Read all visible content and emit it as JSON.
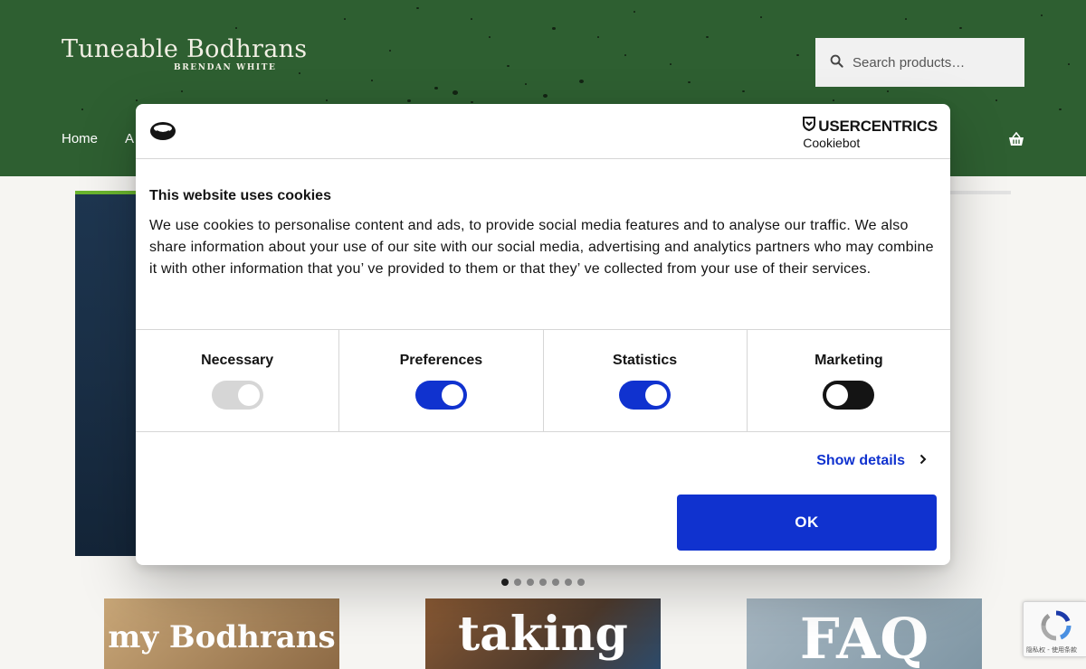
{
  "header": {
    "logo_title": "Tuneable Bodhrans",
    "logo_subtitle": "BRENDAN WHITE",
    "search_placeholder": "Search products…",
    "nav_items": [
      "Home",
      "A"
    ],
    "background_color": "#2e5f31"
  },
  "slider": {
    "slide_count": 7,
    "active_index": 0
  },
  "tiles": [
    {
      "text": "my Bodhrans",
      "color": "#a7865c"
    },
    {
      "text": "taking",
      "color": "#6b4a2e"
    },
    {
      "text": "FAQ",
      "color": "#8fa3b0"
    }
  ],
  "cookie_dialog": {
    "brand": "USERCENTRICS",
    "brand_sub": "Cookiebot",
    "title": "This website uses cookies",
    "text": "We use cookies to personalise content and ads, to provide social media features and to analyse our traffic. We also share information about your use of our site with our social media, advertising and analytics partners who may combine it with other information that you’ ve provided to them or that they’ ve collected from your use of their services.",
    "categories": [
      {
        "label": "Necessary",
        "state": "on-disabled"
      },
      {
        "label": "Preferences",
        "state": "on"
      },
      {
        "label": "Statistics",
        "state": "on"
      },
      {
        "label": "Marketing",
        "state": "off"
      }
    ],
    "show_details": "Show details",
    "ok_label": "OK",
    "accent_color": "#1032cf"
  },
  "recaptcha": {
    "text": "隐私权 - 使用条款"
  }
}
